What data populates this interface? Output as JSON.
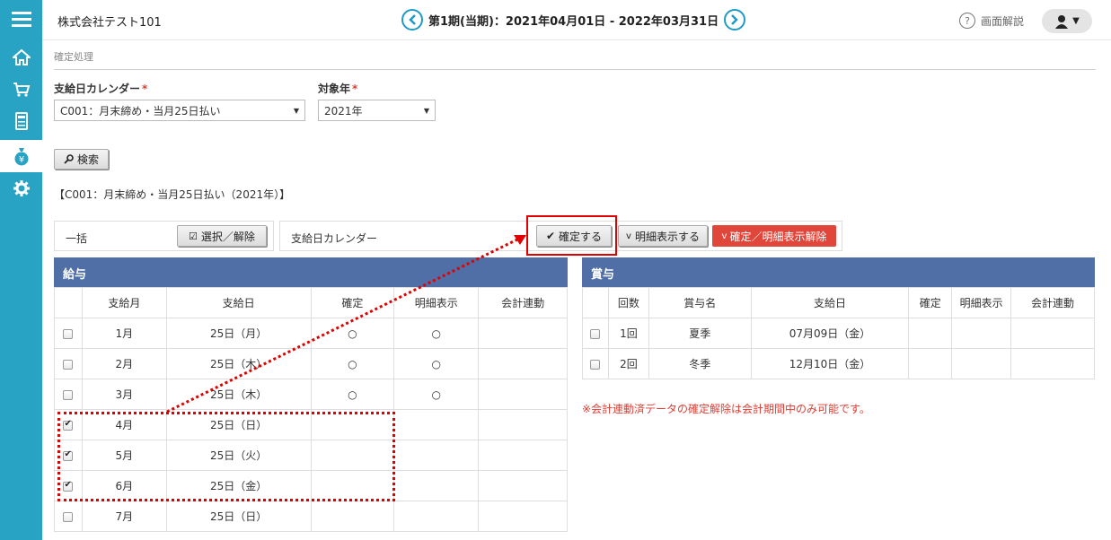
{
  "app": {
    "company": "株式会社テスト101",
    "period": "第1期(当期)：2021年04月01日 - 2022年03月31日",
    "help_label": "画面解説"
  },
  "breadcrumb": "確定処理",
  "form": {
    "calendar_label": "支給日カレンダー",
    "calendar_value": "C001：月末締め・当月25日払い",
    "year_label": "対象年",
    "year_value": "2021年",
    "required_mark": "*",
    "search_label": "検索"
  },
  "summary": "【C001：月末締め・当月25日払い（2021年）】",
  "bulk": {
    "label": "一括",
    "select_toggle": "選択／解除",
    "calendar_label": "支給日カレンダー",
    "confirm": "確定する",
    "show_detail": "明細表示する",
    "cancel": "確定／明細表示解除"
  },
  "salary": {
    "title": "給与",
    "headers": [
      "支給月",
      "支給日",
      "確定",
      "明細表示",
      "会計連動"
    ],
    "rows": [
      {
        "month": "1月",
        "date": "25日（月）",
        "confirmed": "○",
        "detail": "○",
        "checked": false
      },
      {
        "month": "2月",
        "date": "25日（木）",
        "confirmed": "○",
        "detail": "○",
        "checked": false
      },
      {
        "month": "3月",
        "date": "25日（木）",
        "confirmed": "○",
        "detail": "○",
        "checked": false
      },
      {
        "month": "4月",
        "date": "25日（日）",
        "confirmed": "",
        "detail": "",
        "checked": true
      },
      {
        "month": "5月",
        "date": "25日（火）",
        "confirmed": "",
        "detail": "",
        "checked": true
      },
      {
        "month": "6月",
        "date": "25日（金）",
        "confirmed": "",
        "detail": "",
        "checked": true
      },
      {
        "month": "7月",
        "date": "25日（日）",
        "confirmed": "",
        "detail": "",
        "checked": false
      }
    ]
  },
  "bonus": {
    "title": "賞与",
    "headers": [
      "回数",
      "賞与名",
      "支給日",
      "確定",
      "明細表示",
      "会計連動"
    ],
    "rows": [
      {
        "count": "1回",
        "name": "夏季",
        "date": "07月09日（金）"
      },
      {
        "count": "2回",
        "name": "冬季",
        "date": "12月10日（金）"
      }
    ]
  },
  "note": "※会計連動済データの確定解除は会計期間中のみ可能です。",
  "colors": {
    "sidebar": "#29a3c4",
    "table_header": "#4f6fa6",
    "accent_red": "#e0463a",
    "annotation_red": "#e00000"
  }
}
